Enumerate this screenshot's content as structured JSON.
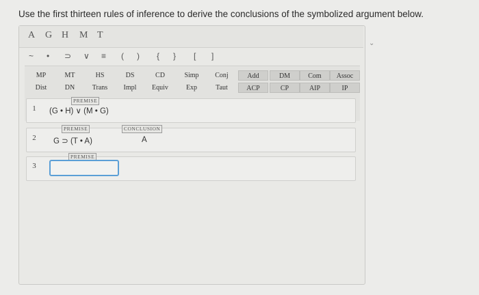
{
  "instructions": "Use the first thirteen rules of inference to derive the conclusions of the symbolized argument below.",
  "letters": [
    "A",
    "G",
    "H",
    "M",
    "T"
  ],
  "symbols": [
    "~",
    "•",
    "⊃",
    "∨",
    "≡",
    "(",
    ")",
    "{",
    "}",
    "[",
    "]"
  ],
  "rules_row1": [
    "MP",
    "MT",
    "HS",
    "DS",
    "CD",
    "Simp",
    "Conj",
    "Add",
    "DM",
    "Com",
    "Assoc"
  ],
  "rules_row2": [
    "Dist",
    "DN",
    "Trans",
    "Impl",
    "Equiv",
    "Exp",
    "Taut",
    "ACP",
    "CP",
    "AIP",
    "IP"
  ],
  "lines": [
    {
      "num": "1",
      "tag": "PREMISE",
      "formula": "(G • H) ∨ (M • G)"
    },
    {
      "num": "2",
      "tag": "PREMISE",
      "formula": "G ⊃ (T • A)",
      "conclusion_tag": "CONCLUSION",
      "conclusion": "A"
    },
    {
      "num": "3",
      "tag": "PREMISE",
      "formula": ""
    }
  ],
  "colors": {
    "focus_border": "#5b9fd6",
    "background": "#ececea"
  }
}
